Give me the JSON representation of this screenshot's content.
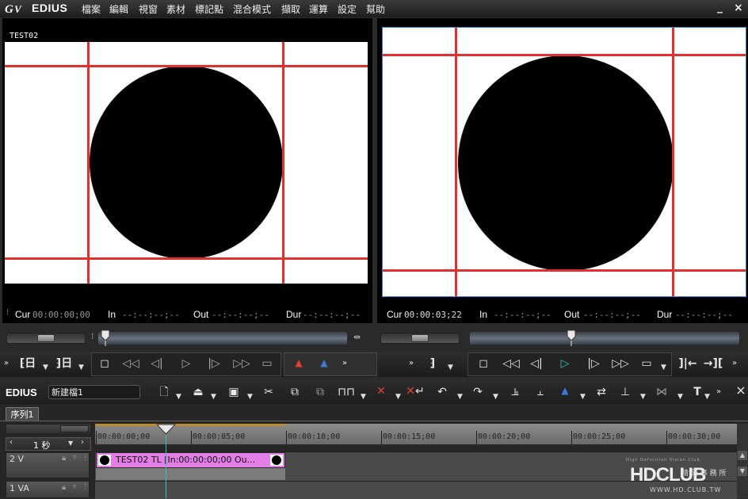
{
  "app": {
    "name": "EDIUS",
    "menu": [
      "檔案",
      "編輯",
      "視窗",
      "素材",
      "標記點",
      "混合模式",
      "擷取",
      "運算",
      "設定",
      "幫助"
    ],
    "minimize": "_",
    "close": "×"
  },
  "player": {
    "clip_name": "TEST02",
    "cur_label": "Cur",
    "cur_value": "00:00:00;00",
    "in_label": "In",
    "in_value": "--:--:--;--",
    "out_label": "Out",
    "out_value": "--:--:--;--",
    "dur_label": "Dur",
    "dur_value": "--:--:--;--"
  },
  "recorder": {
    "cur_label": "Cur",
    "cur_value": "00:00:03;22",
    "in_label": "In",
    "in_value": "--:--:--;--",
    "out_label": "Out",
    "out_value": "--:--:--;--",
    "dur_label": "Dur",
    "dur_value": "--:--:--;--"
  },
  "timeline": {
    "app_label": "EDIUS",
    "project_name": "新建檔1",
    "sequence_tab": "序列1",
    "scale": "1 秒",
    "ruler_labels": [
      "00:00:00;00",
      "00:00:05;00",
      "00:00:10;00",
      "00:00:15;00",
      "00:00:20;00",
      "00:00:25;00",
      "00:00:30;00"
    ],
    "tracks": [
      {
        "name": "2 V"
      },
      {
        "name": "1 VA"
      }
    ],
    "clip_label": "TEST02  TL [In:00:00:00;00 Ou..."
  },
  "watermark": {
    "logo": "HDCLUB",
    "sub_tagline": "High Definition Vision Club",
    "chinese": "精 研 事 務 所",
    "url": "WWW.HD.CLUB.TW"
  },
  "colors": {
    "accent_blue": "#3b7bd6",
    "guide_red": "#e03030",
    "clip_pink": "#e37ee6",
    "timeline_cursor": "#33c0c0",
    "play_teal": "#39c2c2"
  }
}
